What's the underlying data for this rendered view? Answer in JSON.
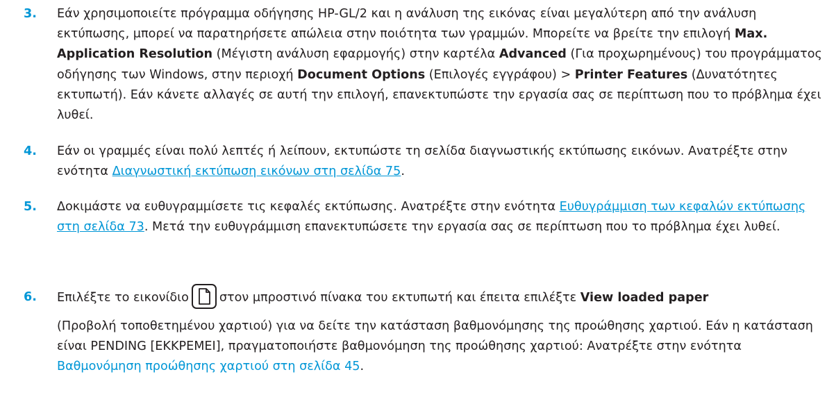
{
  "items": [
    {
      "num": "3.",
      "t1": "Εάν χρησιμοποιείτε πρόγραμμα οδήγησης HP-GL/2 και η ανάλυση της εικόνας είναι μεγαλύτερη από την ανάλυση εκτύπωσης, μπορεί να παρατηρήσετε απώλεια στην ποιότητα των γραμμών. Μπορείτε να βρείτε την επιλογή ",
      "b1": "Max. Application Resolution",
      "t2": " (Μέγιστη ανάλυση εφαρμογής) στην καρτέλα ",
      "b2": "Advanced",
      "t3": " (Για προχωρημένους) του προγράμματος οδήγησης των Windows, στην περιοχή ",
      "b3": "Document Options",
      "t4": " (Επιλογές εγγράφου) > ",
      "b4": "Printer Features",
      "t5": " (Δυνατότητες εκτυπωτή). Εάν κάνετε αλλαγές σε αυτή την επιλογή, επανεκτυπώστε την εργασία σας σε περίπτωση που το πρόβλημα έχει λυθεί."
    },
    {
      "num": "4.",
      "t1": "Εάν οι γραμμές είναι πολύ λεπτές ή λείπουν, εκτυπώστε τη σελίδα διαγνωστικής εκτύπωσης εικόνων. Ανατρέξτε στην ενότητα ",
      "link": "Διαγνωστική εκτύπωση εικόνων στη σελίδα 75",
      "t2": "."
    },
    {
      "num": "5.",
      "t1": "Δοκιμάστε να ευθυγραμμίσετε τις κεφαλές εκτύπωσης. Ανατρέξτε στην ενότητα ",
      "link": "Ευθυγράμμιση των κεφαλών εκτύπωσης στη σελίδα 73",
      "t2": ". Μετά την ευθυγράμμιση επανεκτυπώσετε την εργασία σας σε περίπτωση που το πρόβλημα έχει λυθεί."
    },
    {
      "num": "6.",
      "t1": "Επιλέξτε το εικονίδιο",
      "t2": "στον μπροστινό πίνακα του εκτυπωτή και έπειτα επιλέξτε ",
      "b1": "View loaded paper",
      "t3": "(Προβολή τοποθετημένου χαρτιού) για να δείτε την κατάσταση βαθμονόμησης της προώθησης χαρτιού. Εάν η κατάσταση είναι PENDING [ΕΚΚΡΕΜΕΙ], πραγματοποιήστε βαθμονόμηση της προώθησης χαρτιού: Ανατρέξτε στην ενότητα ",
      "link": "Βαθμονόμηση προώθησης χαρτιού στη σελίδα 45",
      "t4": ".",
      "icon": "paper-icon"
    }
  ],
  "colors": {
    "accent": "#0096d6",
    "text": "#231f20"
  }
}
